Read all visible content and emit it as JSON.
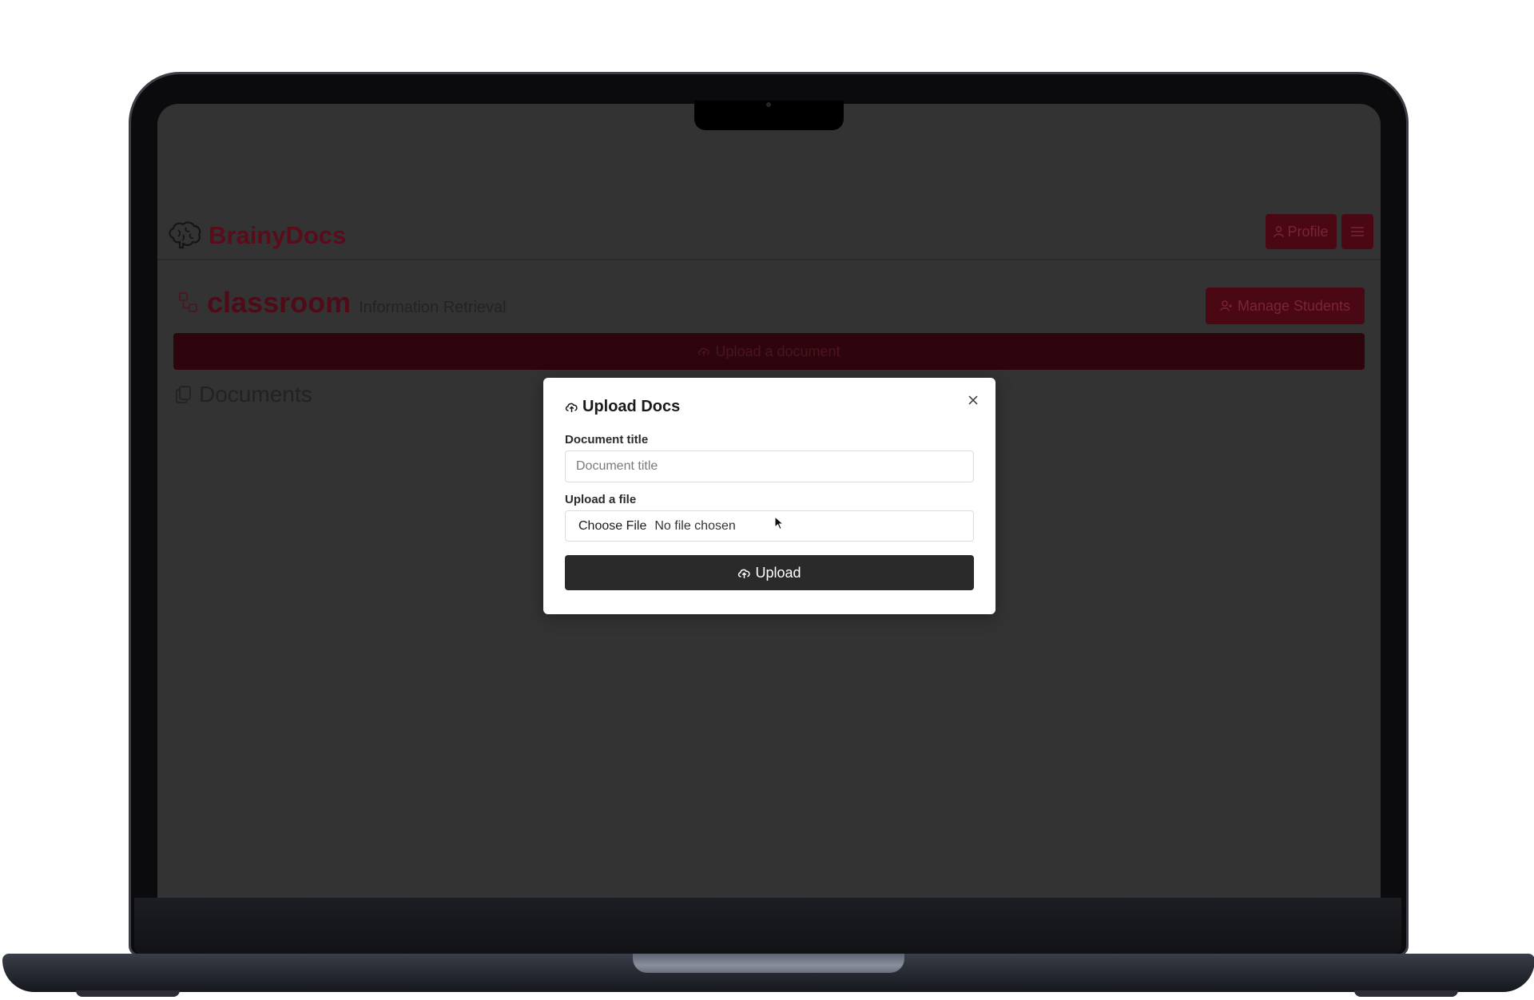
{
  "app": {
    "brand_name": "BrainyDocs",
    "nav": {
      "profile_label": "Profile"
    },
    "classroom": {
      "name": "classroom",
      "subtitle": "Information Retrieval",
      "manage_label": "Manage Students",
      "upload_bar_label": "Upload a document",
      "documents_heading": "Documents"
    }
  },
  "modal": {
    "title": "Upload Docs",
    "doc_title_label": "Document title",
    "doc_title_placeholder": "Document title",
    "doc_title_value": "",
    "file_label": "Upload a file",
    "choose_file_label": "Choose File",
    "no_file_text": "No file chosen",
    "submit_label": "Upload"
  },
  "colors": {
    "accent": "#4a0815",
    "accent_text": "#5a0c1b",
    "overlay_bg": "#333333",
    "modal_bg": "#ffffff",
    "submit_bg": "#2a2a2a"
  }
}
